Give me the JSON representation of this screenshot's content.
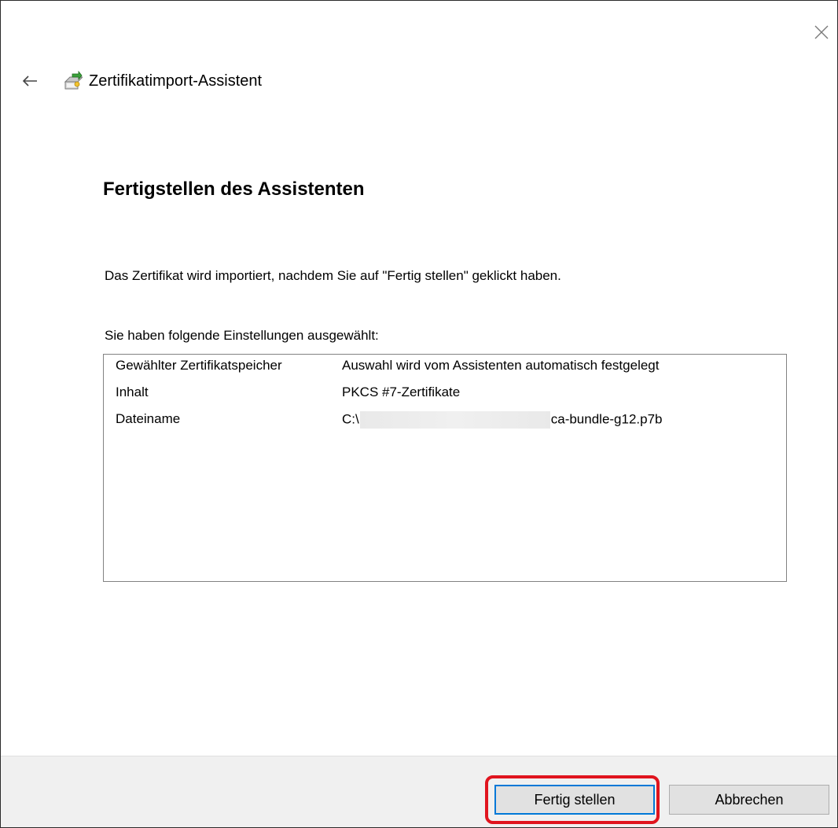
{
  "window": {
    "close_icon": "close-icon",
    "back_icon": "back-arrow-icon",
    "wizard_icon": "certificate-wizard-icon",
    "title": "Zertifikatimport-Assistent"
  },
  "page": {
    "heading": "Fertigstellen des Assistenten",
    "info_text": "Das Zertifikat wird importiert, nachdem Sie auf \"Fertig stellen\" geklickt haben.",
    "settings_label": "Sie haben folgende Einstellungen ausgewählt:"
  },
  "settings": [
    {
      "key": "Gewählter Zertifikatspeicher",
      "value": "Auswahl wird vom Assistenten automatisch festgelegt"
    },
    {
      "key": "Inhalt",
      "value": "PKCS #7-Zertifikate"
    },
    {
      "key": "Dateiname",
      "value_prefix": "C:\\",
      "value_suffix": "ca-bundle-g12.p7b"
    }
  ],
  "buttons": {
    "finish": "Fertig stellen",
    "cancel": "Abbrechen"
  },
  "colors": {
    "highlight": "#e0141e",
    "focus_border": "#0078d7",
    "footer_bg": "#f0f0f0"
  }
}
